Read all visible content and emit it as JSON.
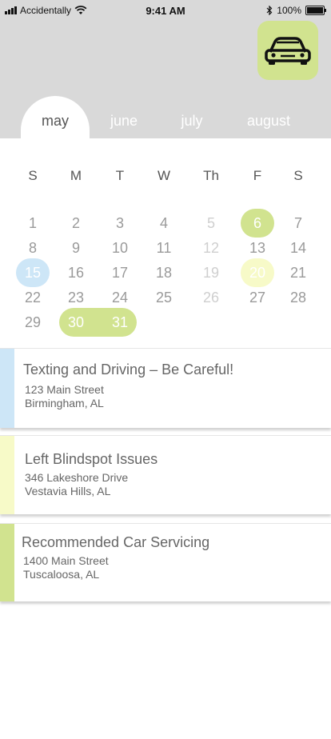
{
  "status_bar": {
    "carrier": "Accidentally",
    "time": "9:41 AM",
    "battery": "100%",
    "battery_level": 1.0
  },
  "header": {
    "car_icon": "car-icon",
    "accent": "#d1e38f"
  },
  "tabs": [
    {
      "label": "may",
      "active": true
    },
    {
      "label": "june",
      "active": false
    },
    {
      "label": "july",
      "active": false
    },
    {
      "label": "august",
      "active": false
    }
  ],
  "calendar": {
    "weekdays": [
      "S",
      "M",
      "T",
      "W",
      "Th",
      "F",
      "S"
    ],
    "rows": [
      [
        "1",
        "2",
        "3",
        "4",
        "5",
        "6",
        "7"
      ],
      [
        "8",
        "9",
        "10",
        "11",
        "12",
        "13",
        "14"
      ],
      [
        "15",
        "16",
        "17",
        "18",
        "19",
        "20",
        "21"
      ],
      [
        "22",
        "23",
        "24",
        "25",
        "26",
        "27",
        "28"
      ],
      [
        "29",
        "30",
        "31",
        "",
        "",
        "",
        ""
      ]
    ],
    "dimmed_dates": [
      "5",
      "12",
      "19",
      "26"
    ],
    "highlights": [
      {
        "dates": [
          "6"
        ],
        "color": "#d1e38f"
      },
      {
        "dates": [
          "15"
        ],
        "color": "#cde6f7"
      },
      {
        "dates": [
          "20"
        ],
        "color": "#f7fac8"
      },
      {
        "dates": [
          "30",
          "31"
        ],
        "color": "#d1e38f"
      }
    ]
  },
  "events": [
    {
      "title": "Texting and Driving – Be Careful!",
      "address": "123 Main Street",
      "city": "Birmingham, AL",
      "color": "#cde6f7"
    },
    {
      "title": "Left Blindspot Issues",
      "address": "346 Lakeshore Drive",
      "city": "Vestavia Hills, AL",
      "color": "#f7fac8"
    },
    {
      "title": "Recommended Car Servicing",
      "address": "1400 Main Street",
      "city": "Tuscaloosa, AL",
      "color": "#d1e38f"
    }
  ]
}
